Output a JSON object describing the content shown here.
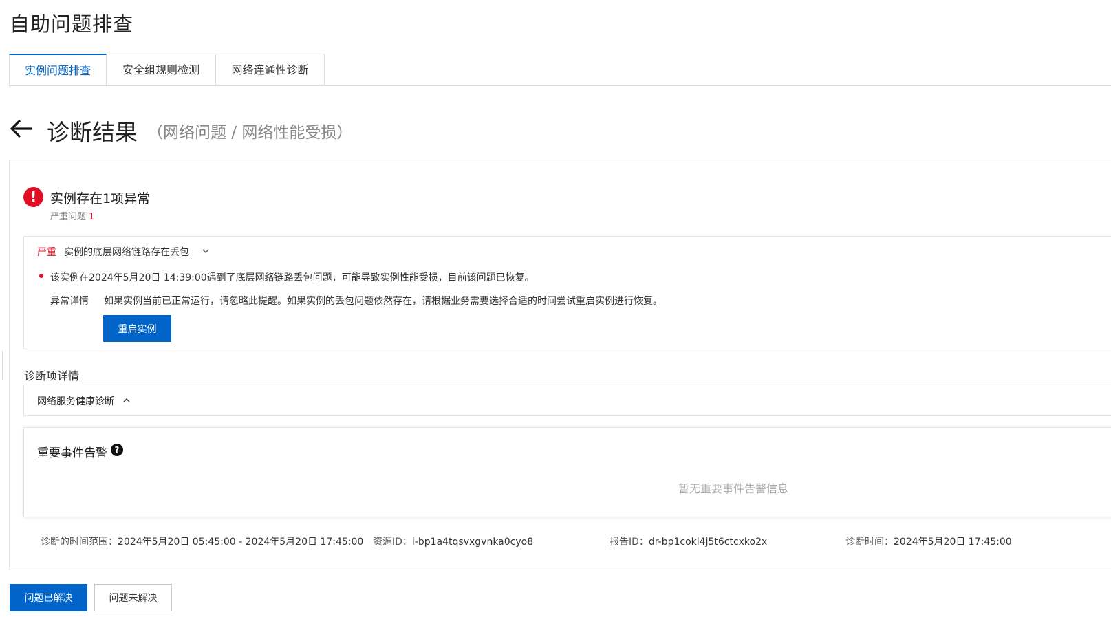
{
  "page": {
    "title": "自助问题排查"
  },
  "tabs": [
    {
      "label": "实例问题排查",
      "active": true
    },
    {
      "label": "安全组规则检测",
      "active": false
    },
    {
      "label": "网络连通性诊断",
      "active": false
    }
  ],
  "result": {
    "back_icon": "arrow-left-icon",
    "title": "诊断结果",
    "subtitle": "（网络问题 / 网络性能受损）"
  },
  "summary": {
    "icon": "exclamation-circle-icon",
    "title": "实例存在1项异常",
    "severe_label": "严重问题",
    "severe_count": "1"
  },
  "issue": {
    "severity": "严重",
    "title": "实例的底层网络链路存在丢包",
    "description": "该实例在2024年5月20日 14:39:00遇到了底层网络链路丢包问题，可能导致实例性能受损，目前该问题已恢复。",
    "detail_label": "异常详情",
    "detail_text": "如果实例当前已正常运行，请忽略此提醒。如果实例的丢包问题依然存在，请根据业务需要选择合适的时间尝试重启实例进行恢复。",
    "action_button": "重启实例"
  },
  "diagnosis": {
    "section_label": "诊断项详情",
    "item_label": "网络服务健康诊断"
  },
  "events": {
    "title": "重要事件告警",
    "help_icon": "question-circle-icon",
    "empty_text": "暂无重要事件告警信息"
  },
  "meta": {
    "range_label": "诊断的时间范围：",
    "range_value": "2024年5月20日 05:45:00 - 2024年5月20日 17:45:00",
    "resource_label": "资源ID：",
    "resource_value": "i-bp1a4tqsvxgvnka0cyo8",
    "report_label": "报告ID：",
    "report_value": "dr-bp1cokl4j5t6ctcxko2x",
    "time_label": "诊断时间：",
    "time_value": "2024年5月20日 17:45:00"
  },
  "footer": {
    "solved_button": "问题已解决",
    "unsolved_button": "问题未解决"
  },
  "colors": {
    "primary": "#0064c8",
    "danger": "#e00f23",
    "muted": "#888888"
  }
}
